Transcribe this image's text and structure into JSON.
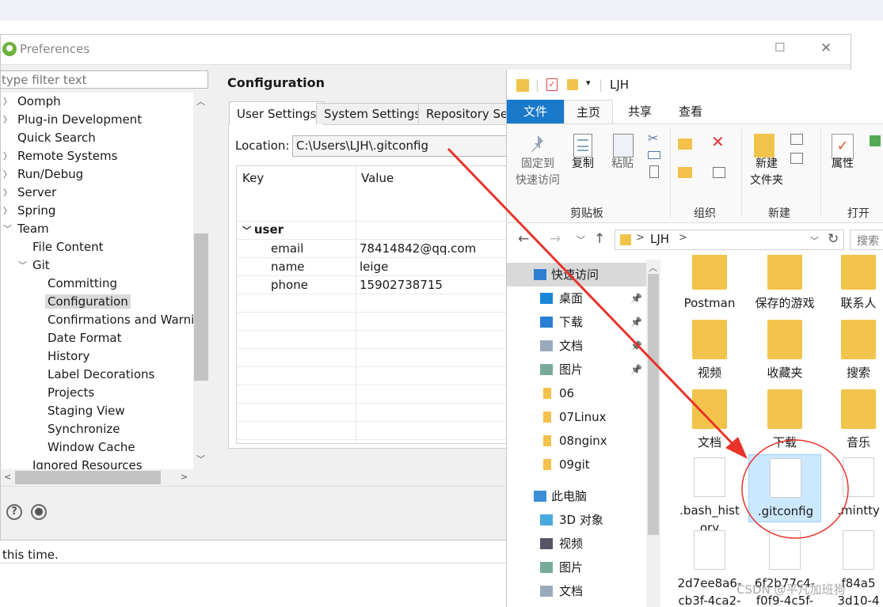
{
  "background": {
    "top_bar_color": "#f1f2f8"
  },
  "preferences": {
    "title": "Preferences",
    "filter_placeholder": "type filter text",
    "tree": [
      {
        "label": "Oomph",
        "level": 0,
        "expander": ">"
      },
      {
        "label": "Plug-in Development",
        "level": 0,
        "expander": ">"
      },
      {
        "label": "Quick Search",
        "level": 0,
        "expander": ""
      },
      {
        "label": "Remote Systems",
        "level": 0,
        "expander": ">"
      },
      {
        "label": "Run/Debug",
        "level": 0,
        "expander": ">"
      },
      {
        "label": "Server",
        "level": 0,
        "expander": ">"
      },
      {
        "label": "Spring",
        "level": 0,
        "expander": ">"
      },
      {
        "label": "Team",
        "level": 0,
        "expander": "v"
      },
      {
        "label": "File Content",
        "level": 1,
        "expander": ""
      },
      {
        "label": "Git",
        "level": 1,
        "expander": "v"
      },
      {
        "label": "Committing",
        "level": 2,
        "expander": ""
      },
      {
        "label": "Configuration",
        "level": 2,
        "expander": "",
        "selected": true
      },
      {
        "label": "Confirmations and Warnir",
        "level": 2,
        "expander": ""
      },
      {
        "label": "Date Format",
        "level": 2,
        "expander": ""
      },
      {
        "label": "History",
        "level": 2,
        "expander": ""
      },
      {
        "label": "Label Decorations",
        "level": 2,
        "expander": ""
      },
      {
        "label": "Projects",
        "level": 2,
        "expander": ""
      },
      {
        "label": "Staging View",
        "level": 2,
        "expander": ""
      },
      {
        "label": "Synchronize",
        "level": 2,
        "expander": ""
      },
      {
        "label": "Window Cache",
        "level": 2,
        "expander": ""
      },
      {
        "label": "Ignored Resources",
        "level": 1,
        "expander": ""
      }
    ],
    "page_title": "Configuration",
    "tabs": [
      "User Settings",
      "System Settings",
      "Repository Se"
    ],
    "location_label": "Location:",
    "location_value": "C:\\Users\\LJH\\.gitconfig",
    "table": {
      "headers": [
        "Key",
        "Value"
      ],
      "section": "user",
      "rows": [
        {
          "key": "email",
          "value": "78414842@qq.com"
        },
        {
          "key": "name",
          "value": "leige"
        },
        {
          "key": "phone",
          "value": "15902738715"
        }
      ]
    },
    "help_icon": "question-circle-icon",
    "record_icon": "record-circle-icon",
    "status_text": "this time."
  },
  "explorer": {
    "title": "LJH",
    "ribbon_tabs": [
      "文件",
      "主页",
      "共享",
      "查看"
    ],
    "accent": "#1979ca",
    "ribbon_buttons": [
      {
        "label1": "固定到",
        "label2": "快速访问",
        "icon": "pin-icon"
      },
      {
        "label1": "复制",
        "label2": "",
        "icon": "copy-icon"
      },
      {
        "label1": "粘贴",
        "label2": "",
        "icon": "paste-icon"
      },
      {
        "label1": "新建",
        "label2": "文件夹",
        "icon": "new-folder-icon"
      },
      {
        "label1": "属性",
        "label2": "",
        "icon": "properties-icon"
      }
    ],
    "ribbon_groups": [
      "剪贴板",
      "组织",
      "新建",
      "打开"
    ],
    "address_path": "LJH",
    "search_placeholder": "搜索",
    "nav_items": [
      {
        "label": "快速访问",
        "icon": "star-icon",
        "level": 0,
        "highlight": true
      },
      {
        "label": "桌面",
        "icon": "desktop-icon",
        "level": 1,
        "pinned": true
      },
      {
        "label": "下载",
        "icon": "download-icon",
        "level": 1,
        "pinned": true
      },
      {
        "label": "文档",
        "icon": "document-icon",
        "level": 1,
        "pinned": true
      },
      {
        "label": "图片",
        "icon": "pictures-icon",
        "level": 1,
        "pinned": true
      },
      {
        "label": "06",
        "icon": "folder-icon",
        "level": 1
      },
      {
        "label": "07Linux",
        "icon": "folder-icon",
        "level": 1
      },
      {
        "label": "08nginx",
        "icon": "folder-icon",
        "level": 1
      },
      {
        "label": "09git",
        "icon": "folder-icon",
        "level": 1
      },
      {
        "label": "此电脑",
        "icon": "computer-icon",
        "level": 0
      },
      {
        "label": "3D 对象",
        "icon": "3d-objects-icon",
        "level": 1
      },
      {
        "label": "视频",
        "icon": "video-icon",
        "level": 1
      },
      {
        "label": "图片",
        "icon": "pictures-icon",
        "level": 1
      },
      {
        "label": "文档",
        "icon": "document-icon",
        "level": 1
      }
    ],
    "files": [
      {
        "name": "Postman",
        "icon": "folder-icon"
      },
      {
        "name": "保存的游戏",
        "icon": "saved-games-icon"
      },
      {
        "name": "联系人",
        "icon": "contacts-icon"
      },
      {
        "name": "视频",
        "icon": "video-folder-icon"
      },
      {
        "name": "收藏夹",
        "icon": "favorites-icon"
      },
      {
        "name": "搜索",
        "icon": "search-folder-icon"
      },
      {
        "name": "文档",
        "icon": "documents-folder-icon"
      },
      {
        "name": "下载",
        "icon": "downloads-folder-icon"
      },
      {
        "name": "音乐",
        "icon": "music-folder-icon"
      },
      {
        "name": ".bash_hist",
        "name2": "ory",
        "icon": "file-icon"
      },
      {
        "name": ".gitconfig",
        "icon": "file-icon",
        "selected": true
      },
      {
        "name": ".mintty",
        "icon": "file-icon"
      },
      {
        "name": "2d7ee8a6-",
        "name2": "cb3f-4ca2-",
        "icon": "file-icon"
      },
      {
        "name": "6f2b77c4-",
        "name2": "f0f9-4c5f-",
        "icon": "file-icon"
      },
      {
        "name": "f84a5",
        "name2": "3d10-4",
        "icon": "file-icon"
      }
    ],
    "watermark": "CSDN @平凡加班狗"
  },
  "annotation": {
    "color": "#e8332a"
  }
}
